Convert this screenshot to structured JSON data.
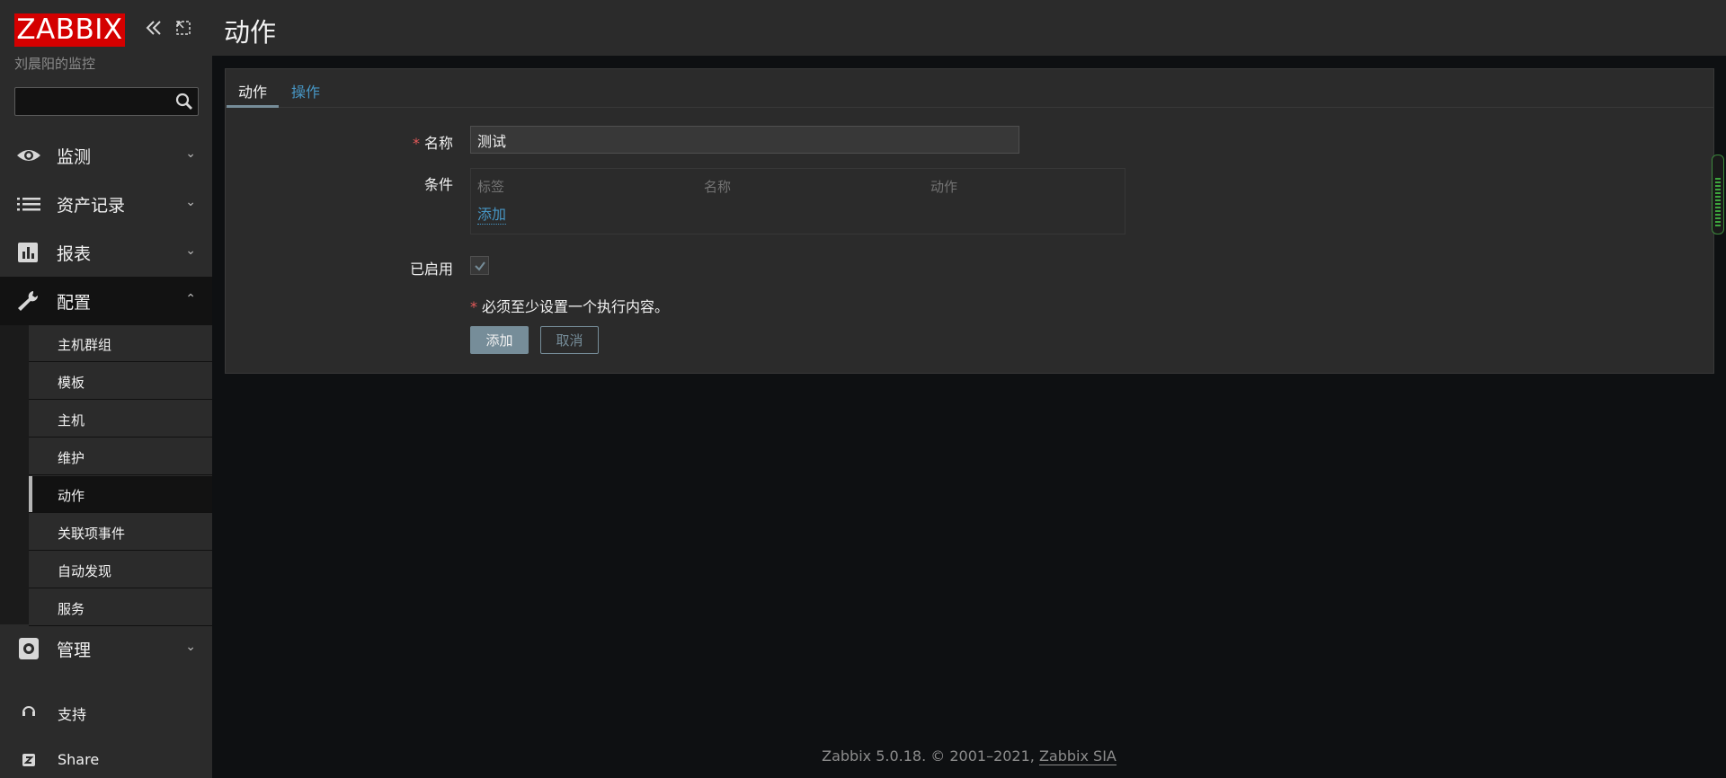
{
  "sidebar": {
    "logo": "ZABBIX",
    "server_name": "刘晨阳的监控",
    "search": {
      "value": "",
      "placeholder": ""
    },
    "menu": [
      {
        "label": "监测",
        "icon": "eye-icon",
        "expanded": false
      },
      {
        "label": "资产记录",
        "icon": "list-icon",
        "expanded": false
      },
      {
        "label": "报表",
        "icon": "bar-chart-icon",
        "expanded": false
      },
      {
        "label": "配置",
        "icon": "wrench-icon",
        "expanded": true
      },
      {
        "label": "管理",
        "icon": "gear-icon",
        "expanded": false
      }
    ],
    "submenu": [
      {
        "label": "主机群组"
      },
      {
        "label": "模板"
      },
      {
        "label": "主机"
      },
      {
        "label": "维护"
      },
      {
        "label": "动作",
        "active": true
      },
      {
        "label": "关联项事件"
      },
      {
        "label": "自动发现"
      },
      {
        "label": "服务"
      }
    ],
    "bottom": [
      {
        "label": "支持",
        "icon": "headset-icon"
      },
      {
        "label": "Share",
        "icon": "share-z-icon"
      }
    ]
  },
  "header": {
    "title": "动作"
  },
  "tabs": [
    {
      "label": "动作",
      "active": true
    },
    {
      "label": "操作",
      "active": false
    }
  ],
  "form": {
    "name_label": "名称",
    "name_value": "测试",
    "conditions_label": "条件",
    "conditions_columns": [
      "标签",
      "名称",
      "动作"
    ],
    "conditions_add": "添加",
    "enabled_label": "已启用",
    "enabled": true,
    "required_note": "必须至少设置一个执行内容。",
    "add_button": "添加",
    "cancel_button": "取消"
  },
  "footer": {
    "text": "Zabbix 5.0.18. © 2001–2021, ",
    "link": "Zabbix SIA"
  },
  "colors": {
    "logo_bg": "#d40000",
    "link": "#4796c4",
    "button": "#768d99",
    "required": "#e45959"
  }
}
